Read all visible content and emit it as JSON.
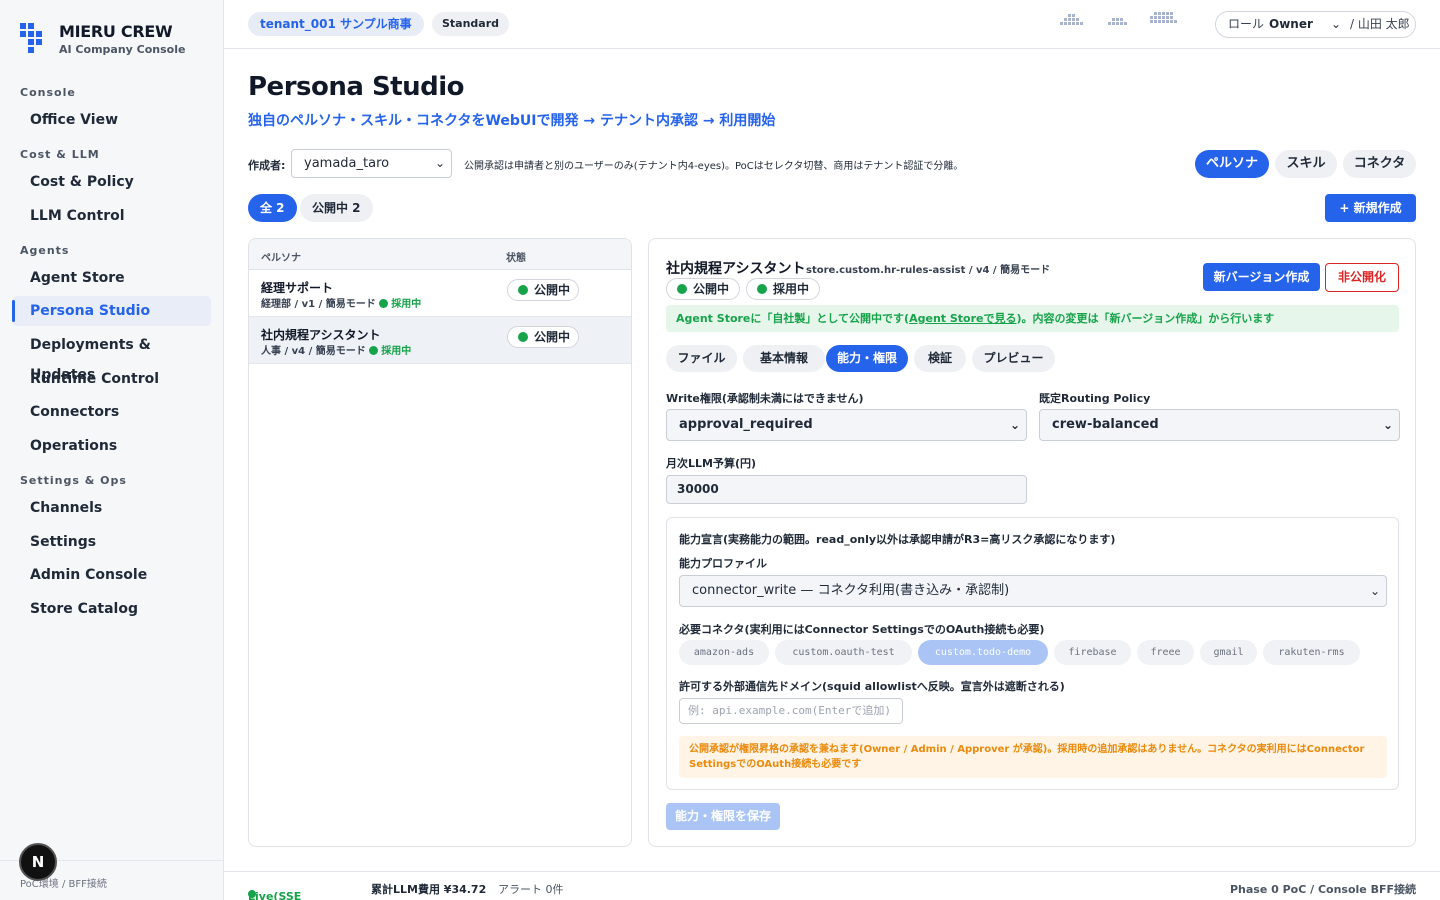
{
  "brand": {
    "title": "MIERU CREW",
    "subtitle": "AI Company Console"
  },
  "sidebar": {
    "sections": [
      {
        "label": "Console",
        "items": [
          "Office View"
        ]
      },
      {
        "label": "Cost & LLM",
        "items": [
          "Cost & Policy",
          "LLM Control"
        ]
      },
      {
        "label": "Agents",
        "items": [
          "Agent Store",
          "Persona Studio",
          "Deployments & Updates",
          "Runtime Control",
          "Connectors",
          "Operations"
        ]
      },
      {
        "label": "Settings & Ops",
        "items": [
          "Channels",
          "Settings",
          "Admin Console",
          "Store Catalog"
        ]
      }
    ],
    "active_item": "Persona Studio",
    "footer": "PoC環境 / BFF接続",
    "badge": "N"
  },
  "topbar": {
    "tenant": "tenant_001 サンプル商事",
    "plan": "Standard",
    "role_label": "ロール",
    "role_value": "Owner",
    "user": "/ 山田 太郎"
  },
  "page": {
    "title": "Persona Studio",
    "subtitle": "独自のペルソナ・スキル・コネクタをWebUIで開発 → テナント内承認 → 利用開始",
    "author_label": "作成者:",
    "author_value": "yamada_taro",
    "author_note": "公開承認は申請者と別のユーザーのみ(テナント内4-eyes)。PoCはセレクタ切替、商用はテナント認証で分離。",
    "type_tabs": [
      "ペルソナ",
      "スキル",
      "コネクタ"
    ],
    "type_tab_active": "ペルソナ",
    "filters": [
      "全 2",
      "公開中 2"
    ],
    "new_button": "+ 新規作成"
  },
  "list": {
    "columns": [
      "ペルソナ",
      "状態"
    ],
    "rows": [
      {
        "title": "経理サポート",
        "meta": "経理部 / v1 / 簡易モード",
        "adopt": "採用中",
        "status": "公開中"
      },
      {
        "title": "社内規程アシスタント",
        "meta": "人事 / v4 / 簡易モード",
        "adopt": "採用中",
        "status": "公開中"
      }
    ]
  },
  "detail": {
    "title": "社内規程アシスタント",
    "meta": "store.custom.hr-rules-assist / v4 / 簡易モード",
    "status_pills": [
      "公開中",
      "採用中"
    ],
    "new_version_button": "新バージョン作成",
    "unpublish_button": "非公開化",
    "notice": {
      "before": "Agent Storeに「自社製」として公開中です(",
      "link": "Agent Storeで見る",
      "after": ")。内容の変更は「新バージョン作成」から行います"
    },
    "tabs": [
      "ファイル",
      "基本情報",
      "能力・権限",
      "検証",
      "プレビュー"
    ],
    "active_tab": "能力・権限",
    "write_label": "Write権限(承認制未満にはできません)",
    "write_value": "approval_required",
    "routing_label": "既定Routing Policy",
    "routing_value": "crew-balanced",
    "budget_label": "月次LLM予算(円)",
    "budget_value": "30000",
    "capability": {
      "declaration_label": "能力宣言(実務能力の範囲。read_only以外は承認申請がR3=高リスク承認になります)",
      "profile_label": "能力プロファイル",
      "profile_value": "connector_write — コネクタ利用(書き込み・承認制)",
      "connectors_label": "必要コネクタ(実利用にはConnector SettingsでのOAuth接続も必要)",
      "connectors": [
        {
          "name": "amazon-ads",
          "selected": false
        },
        {
          "name": "custom.oauth-test",
          "selected": false
        },
        {
          "name": "custom.todo-demo",
          "selected": true
        },
        {
          "name": "firebase",
          "selected": false
        },
        {
          "name": "freee",
          "selected": false
        },
        {
          "name": "gmail",
          "selected": false
        },
        {
          "name": "rakuten-rms",
          "selected": false
        }
      ],
      "domain_label": "許可する外部通信先ドメイン(squid allowlistへ反映。宣言外は遮断される)",
      "domain_placeholder": "例: api.example.com(Enterで追加)",
      "warning": "公開承認が権限昇格の承認を兼ねます(Owner / Admin / Approver が承認)。採用時の追加承認はありません。コネクタの実利用にはConnector SettingsでのOAuth接続も必要です"
    },
    "save_button": "能力・権限を保存"
  },
  "footer": {
    "live": "Live(SSE接続中)",
    "cost": "累計LLM費用 ¥34.72",
    "alerts": "アラート 0件",
    "phase": "Phase 0 PoC / Console BFF接続"
  },
  "colors": {
    "accent": "#2563eb",
    "success": "#16a34a",
    "danger": "#dc2626",
    "warning": "#ea8a0c"
  }
}
